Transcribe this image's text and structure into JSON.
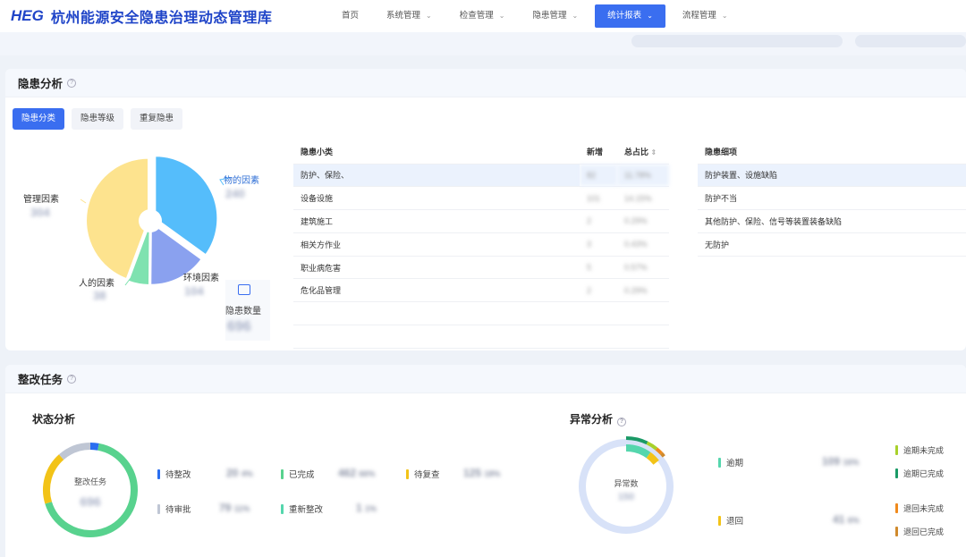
{
  "header": {
    "logo_mark": "HEG",
    "title": "杭州能源安全隐患治理动态管理库",
    "nav": [
      {
        "label": "首页",
        "has_menu": false,
        "active": false
      },
      {
        "label": "系统管理",
        "has_menu": true,
        "active": false
      },
      {
        "label": "检查管理",
        "has_menu": true,
        "active": false
      },
      {
        "label": "隐患管理",
        "has_menu": true,
        "active": false
      },
      {
        "label": "统计报表",
        "has_menu": true,
        "active": true
      },
      {
        "label": "流程管理",
        "has_menu": true,
        "active": false
      }
    ],
    "chevron": "⌄"
  },
  "hazard_analysis": {
    "title": "隐患分析",
    "help_icon": "?",
    "tabs": [
      "隐患分类",
      "隐患等级",
      "重复隐患"
    ],
    "active_tab": 0,
    "pie": {
      "labels": {
        "wu": "物的因素",
        "guanli": "管理因素",
        "huanjing": "环境因素",
        "ren": "人的因素"
      },
      "values_blurred": {
        "wu": "240",
        "guanli": "304",
        "huanjing": "104",
        "ren": "38"
      },
      "total_label": "隐患数量",
      "total_value": "696",
      "colors": {
        "wu": "#55bdfb",
        "guanli": "#fde38e",
        "huanjing": "#8aa1ef",
        "ren": "#7fe2b0"
      }
    },
    "table": {
      "headers": [
        "隐患小类",
        "新增",
        "总占比"
      ],
      "sort_icon": "⇕",
      "rows": [
        {
          "name": "防护、保险、",
          "new": "82",
          "pct": "11.78%"
        },
        {
          "name": "设备设施",
          "new": "101",
          "pct": "14.15%"
        },
        {
          "name": "建筑施工",
          "new": "2",
          "pct": "0.29%"
        },
        {
          "name": "相关方作业",
          "new": "3",
          "pct": "0.43%"
        },
        {
          "name": "职业病危害",
          "new": "5",
          "pct": "0.57%"
        },
        {
          "name": "危化品管理",
          "new": "2",
          "pct": "0.29%"
        }
      ]
    },
    "detail": {
      "header": "隐患细项",
      "rows": [
        "防护装置、设施缺陷",
        "防护不当",
        "其他防护、保险、信号等装置装备缺陷",
        "无防护"
      ]
    }
  },
  "rectification": {
    "title": "整改任务",
    "status": {
      "title": "状态分析",
      "center_label": "整改任务",
      "center_value": "696",
      "legend": [
        {
          "label": "待整改",
          "color": "#2a6ef0",
          "value": "20",
          "pct": "4%"
        },
        {
          "label": "已完成",
          "color": "#58d28e",
          "value": "462",
          "pct": "66%"
        },
        {
          "label": "待复查",
          "color": "#f2c318",
          "value": "125",
          "pct": "18%"
        },
        {
          "label": "待审批",
          "color": "#bfc6d4",
          "value": "79",
          "pct": "11%"
        },
        {
          "label": "重新整改",
          "color": "#55d6ad",
          "value": "1",
          "pct": "1%"
        }
      ]
    },
    "abnormal": {
      "title": "异常分析",
      "center_label": "异常数",
      "center_value": "150",
      "left_legend": [
        {
          "label": "逾期",
          "color": "#55d6ad",
          "value": "109",
          "pct": "16%"
        },
        {
          "label": "退回",
          "color": "#f2c318",
          "value": "41",
          "pct": "6%"
        }
      ],
      "right_legend": [
        {
          "label": "逾期未完成",
          "color": "#a8d12a"
        },
        {
          "label": "逾期已完成",
          "color": "#1a9a66"
        },
        {
          "label": "退回未完成",
          "color": "#f08a1c"
        },
        {
          "label": "退回已完成",
          "color": "#d08a2c"
        }
      ]
    }
  }
}
